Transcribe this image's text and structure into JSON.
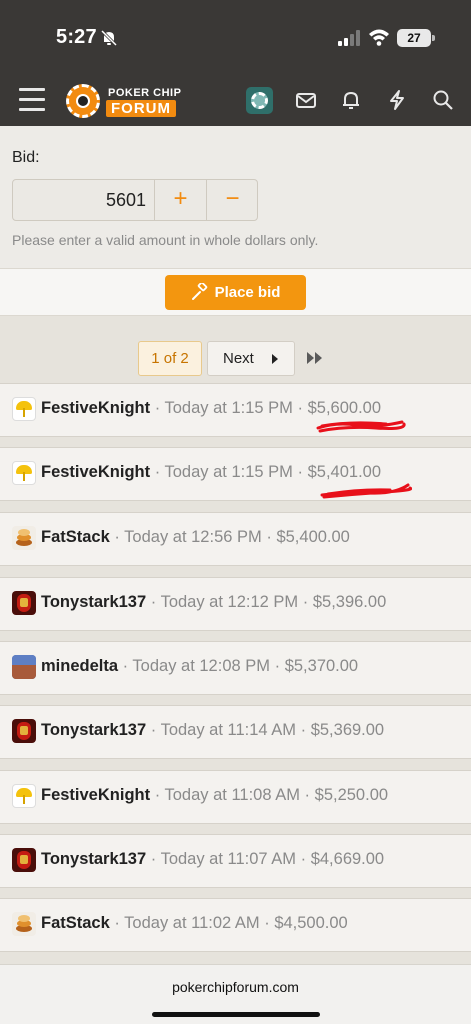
{
  "status_bar": {
    "time": "5:27",
    "battery": "27"
  },
  "header": {
    "logo_top": "POKER CHIP",
    "logo_bottom": "FORUM"
  },
  "bid_form": {
    "label": "Bid:",
    "value": "5601",
    "increment": "+",
    "decrement": "−",
    "help": "Please enter a valid amount in whole dollars only.",
    "submit_label": "Place bid"
  },
  "pagination": {
    "current": "1 of 2",
    "next_label": "Next"
  },
  "bids": [
    {
      "user": "FestiveKnight",
      "time": "Today at 1:15 PM",
      "amount": "$5,600.00",
      "avatar": "umbrella-avatar"
    },
    {
      "user": "FestiveKnight",
      "time": "Today at 1:15 PM",
      "amount": "$5,401.00",
      "avatar": "umbrella-avatar"
    },
    {
      "user": "FatStack",
      "time": "Today at 12:56 PM",
      "amount": "$5,400.00",
      "avatar": "chip-stack-avatar"
    },
    {
      "user": "Tonystark137",
      "time": "Today at 12:12 PM",
      "amount": "$5,396.00",
      "avatar": "iron-man-avatar"
    },
    {
      "user": "minedelta",
      "time": "Today at 12:08 PM",
      "amount": "$5,370.00",
      "avatar": "landscape-avatar"
    },
    {
      "user": "Tonystark137",
      "time": "Today at 11:14 AM",
      "amount": "$5,369.00",
      "avatar": "iron-man-avatar"
    },
    {
      "user": "FestiveKnight",
      "time": "Today at 11:08 AM",
      "amount": "$5,250.00",
      "avatar": "umbrella-avatar"
    },
    {
      "user": "Tonystark137",
      "time": "Today at 11:07 AM",
      "amount": "$4,669.00",
      "avatar": "iron-man-avatar"
    },
    {
      "user": "FatStack",
      "time": "Today at 11:02 AM",
      "amount": "$4,500.00",
      "avatar": "chip-stack-avatar"
    }
  ],
  "sep": "·",
  "browser": {
    "url": "pokerchipforum.com"
  },
  "colors": {
    "accent": "#f3960f",
    "bar": "#3a3836",
    "scribble": "#e8101a"
  }
}
